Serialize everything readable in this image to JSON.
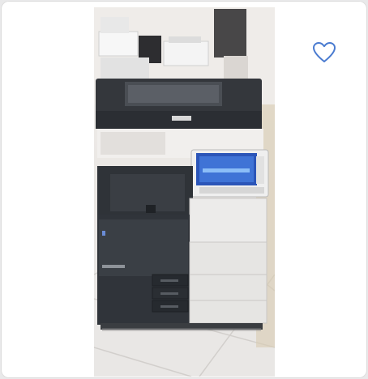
{
  "listing": {
    "image_subject": "multifunction-copier",
    "favorite_icon": "heart-outline-icon",
    "favorite_color": "#4a7bd0",
    "machine_brand_color": "#2f3338"
  }
}
